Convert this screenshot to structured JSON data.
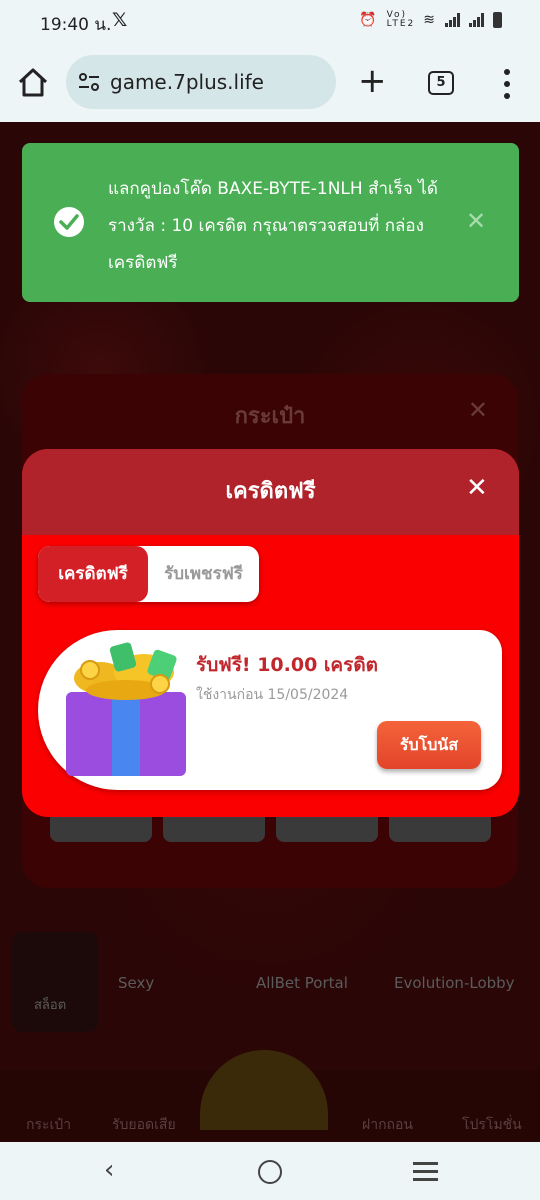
{
  "status_bar": {
    "time": "19:40 น.",
    "x_icon": "x-logo-icon",
    "icons": [
      "alarm-icon",
      "volte-icon",
      "wifi-icon",
      "signal-icon",
      "signal-icon",
      "battery-icon"
    ]
  },
  "browser": {
    "url": "game.7plus.life",
    "tab_count": "5",
    "icons": [
      "home-icon",
      "site-settings-icon",
      "new-tab-icon",
      "tabs-icon",
      "menu-icon"
    ]
  },
  "toast": {
    "message": "แลกคูปองโค๊ด BAXE-BYTE-1NLH สำเร็จ ได้รางวัล : 10 เครดิต กรุณาตรวจสอบที่ กล่องเครดิตฟรี",
    "color": "#4aaf54",
    "icons": [
      "check-circle-icon",
      "close-icon"
    ]
  },
  "background": {
    "wallet_title": "กระเป๋า",
    "games": [
      "Sexy",
      "AllBet Portal",
      "Evolution-Lobby"
    ],
    "bottom_nav": [
      "กระเป๋า",
      "รับยอดเสีย",
      "ฝากถอน",
      "โปรโมชั่น"
    ],
    "side_labels": [
      "สล็อต"
    ]
  },
  "modal": {
    "title": "เครดิตฟรี",
    "tabs": [
      {
        "label": "เครดิตฟรี",
        "active": true
      },
      {
        "label": "รับเพชรฟรี",
        "active": false
      }
    ],
    "card": {
      "title": "รับฟรี! 10.00 เครดิต",
      "expiry": "ใช้งานก่อน 15/05/2024",
      "button": "รับโบนัส",
      "image": "gift-box-icon"
    },
    "colors": {
      "body": "#fb0000",
      "header": "#b0232a",
      "button": "#f4633a"
    }
  },
  "nav": {
    "icons": [
      "back-icon",
      "home-circle-icon",
      "recents-icon"
    ]
  }
}
